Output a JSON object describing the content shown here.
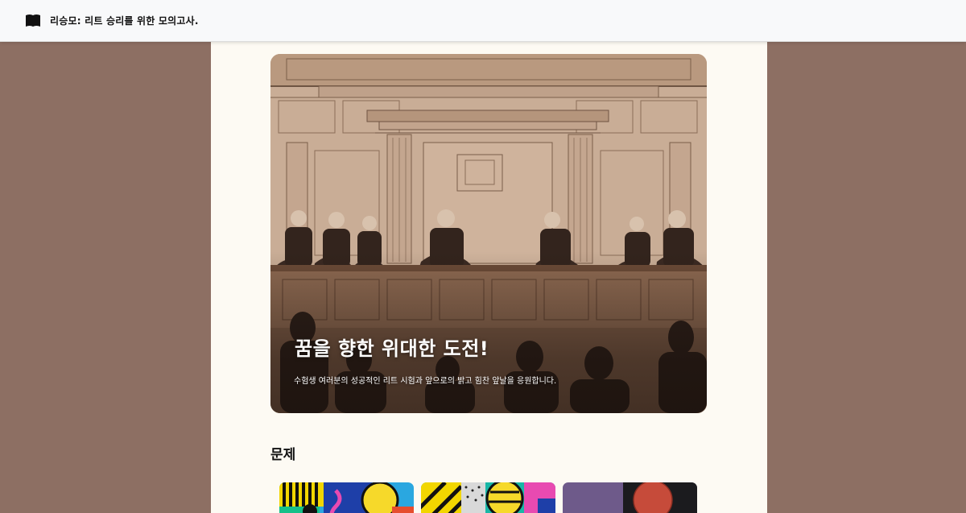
{
  "header": {
    "title": "리승모: 리트 승리를 위한 모의고사.",
    "logo_icon": "book-icon"
  },
  "hero": {
    "title": "꿈을 향한 위대한 도전!",
    "subtitle": "수험생 여러분의 성공적인 리트 시험과 앞으로의 밝고 힘찬 앞날을 응원합니다.",
    "image_icon": "courtroom-illustration"
  },
  "problems": {
    "heading": "문제",
    "cards": [
      {
        "image_icon": "pop-art-thumbnail"
      },
      {
        "image_icon": "pop-art-thumbnail"
      },
      {
        "image_icon": "abstract-thumbnail"
      }
    ]
  },
  "colors": {
    "page_background": "#8d6f63",
    "content_background": "#fdfaf3",
    "header_background": "#f8f9fa"
  }
}
